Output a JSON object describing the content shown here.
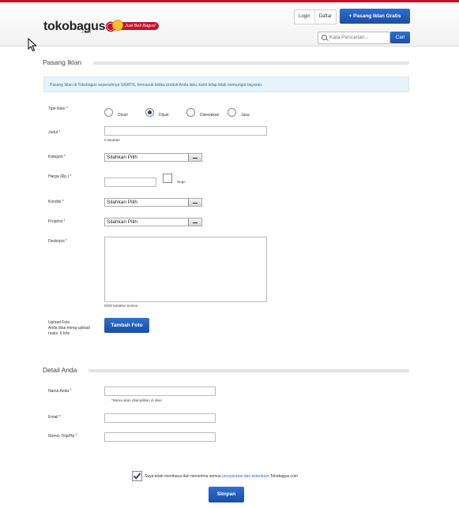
{
  "header": {
    "logo_main": "tokobagus",
    "logo_suffix": ".com",
    "badge": "Jual Beli Bagus!",
    "login": "Login",
    "register": "Daftar",
    "post_ad_button": "+ Pasang Iklan Gratis",
    "search_placeholder": "Kata Pencarian...",
    "search_button": "Cari"
  },
  "form": {
    "section_title": "Pasang Iklan",
    "notice": "Pasang Iklan di Tokobagus sepenuhnya GRATIS, termasuk ketika produk Anda laku, kami tetap tidak memungut bayaran.",
    "ad_type_label": "Tipe Iklan",
    "ad_types": [
      {
        "label": "Dicari",
        "selected": false
      },
      {
        "label": "Dijual",
        "selected": true
      },
      {
        "label": "Disewakan",
        "selected": false
      },
      {
        "label": "Jasa",
        "selected": false
      }
    ],
    "title_label": "Judul",
    "title_counter": "0 karakter",
    "category_label": "Kategori",
    "category_value": "Silahkan Pilih",
    "price_label": "Harga (Rp.)",
    "nego_label": "Nego",
    "condition_label": "Kondisi",
    "condition_value": "Silahkan Pilih",
    "province_label": "Propinsi",
    "province_value": "Silahkan Pilih",
    "description_label": "Deskripsi",
    "description_counter": "5000 karakter tersisa",
    "upload_label_1": "Upload Foto",
    "upload_label_2": "Anda bisa meng-upload",
    "upload_label_3": "maks. 6 foto",
    "upload_button": "Tambah Foto",
    "required_mark": "*"
  },
  "details": {
    "section_title": "Detail Anda",
    "name_label": "Nama Anda",
    "name_hint": "*Nama akan ditampilkan di iklan",
    "email_label": "Email",
    "phone_label": "Nomor Telp/Hp"
  },
  "footer": {
    "agree_prefix": "Saya telah membaca dan menerima semua",
    "agree_link": "persyaratan dan ketentuan",
    "agree_suffix": "Tokobagus.com",
    "submit_button": "Simpan"
  }
}
